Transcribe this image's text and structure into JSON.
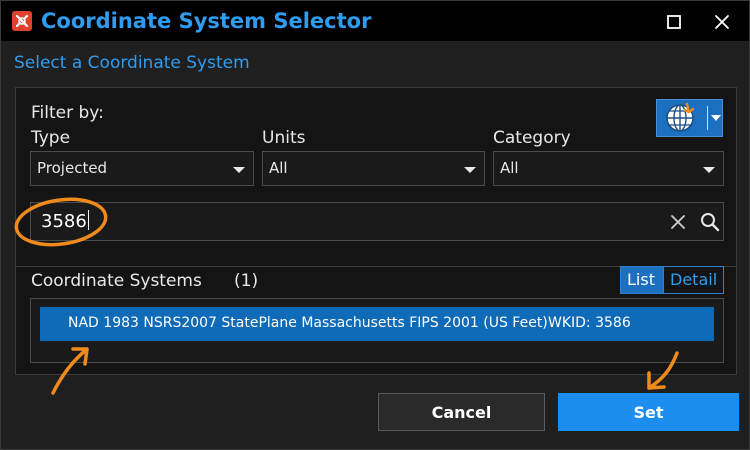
{
  "window": {
    "title": "Coordinate System Selector",
    "heading": "Select a Coordinate System"
  },
  "filter": {
    "label": "Filter by:",
    "type": {
      "label": "Type",
      "value": "Projected"
    },
    "units": {
      "label": "Units",
      "value": "All"
    },
    "category": {
      "label": "Category",
      "value": "All"
    }
  },
  "search": {
    "value": "3586"
  },
  "results": {
    "label": "Coordinate Systems",
    "count": "(1)",
    "view_list": "List",
    "view_detail": "Detail",
    "rows": [
      {
        "name": "NAD 1983 NSRS2007 StatePlane Massachusetts FIPS 2001 (US Feet)",
        "wkid": "WKID: 3586"
      }
    ]
  },
  "buttons": {
    "cancel": "Cancel",
    "set": "Set"
  },
  "colors": {
    "accent": "#2f9cf0",
    "selection": "#0f6ab8",
    "annotation": "#f08a1c"
  },
  "icons": {
    "app": "app-logo-icon",
    "globe": "globe-icon",
    "clear": "close-icon",
    "search": "search-icon"
  }
}
